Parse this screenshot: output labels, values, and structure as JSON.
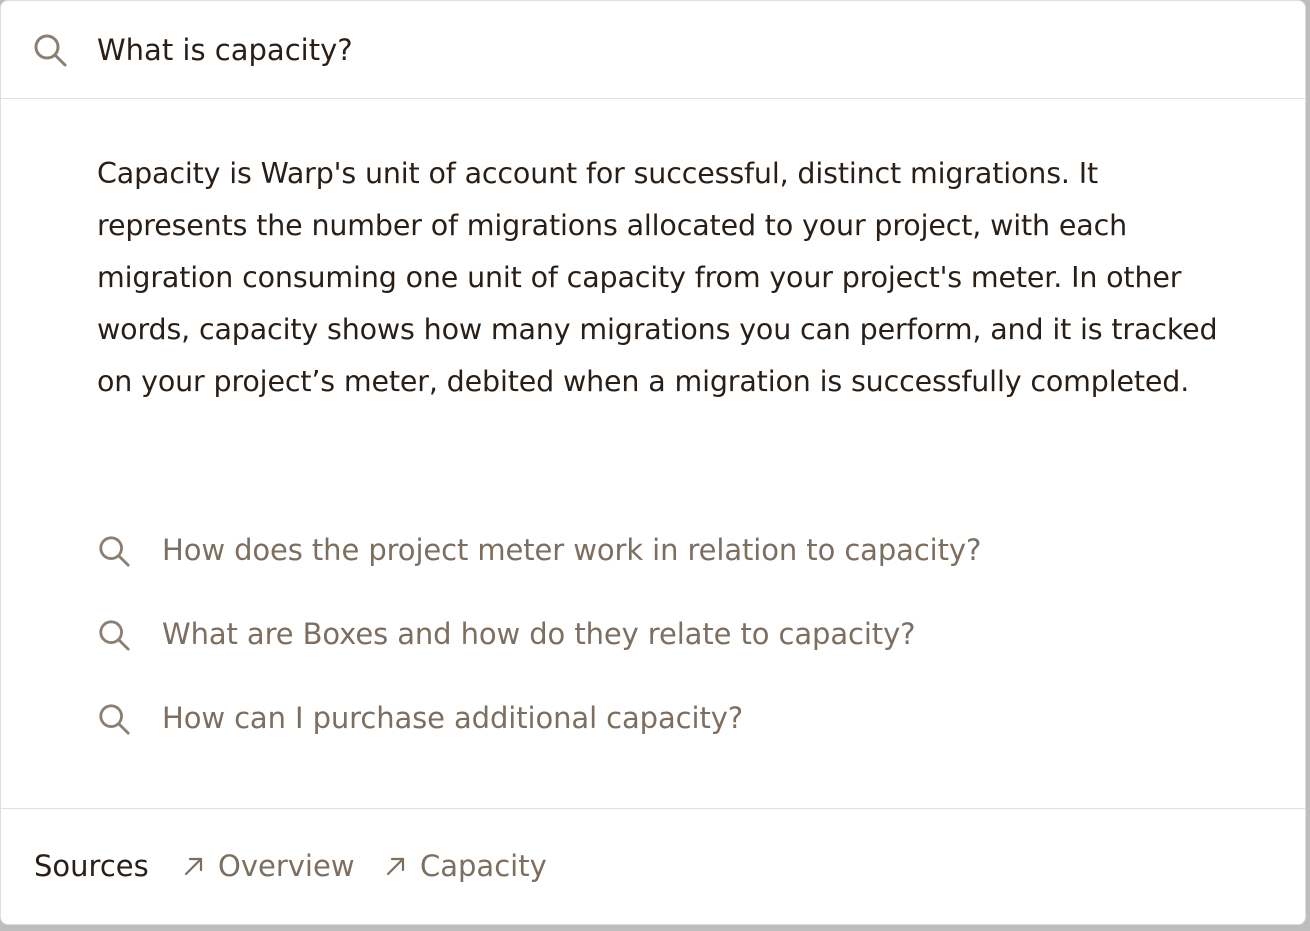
{
  "search": {
    "query": "What is capacity?",
    "icon": "search-icon"
  },
  "answer": {
    "text": "Capacity is Warp's unit of account for successful, distinct migrations. It represents the number of migrations allocated to your project, with each migration consuming one unit of capacity from your project's meter. In other words, capacity shows how many migrations you can perform, and it is tracked on your project’s meter, debited when a migration is successfully completed."
  },
  "suggestions": [
    {
      "label": "How does the project meter work in relation to capacity?",
      "icon": "search-icon"
    },
    {
      "label": "What are Boxes and how do they relate to capacity?",
      "icon": "search-icon"
    },
    {
      "label": "How can I purchase additional capacity?",
      "icon": "search-icon"
    }
  ],
  "footer": {
    "sources_label": "Sources",
    "sources": [
      {
        "label": "Overview",
        "icon": "arrow-up-right-icon"
      },
      {
        "label": "Capacity",
        "icon": "arrow-up-right-icon"
      }
    ]
  },
  "colors": {
    "text_primary": "#2a1f17",
    "text_muted": "#7d6e60",
    "icon": "#8c7f72",
    "border": "#e2dfdb",
    "background": "#ffffff"
  }
}
